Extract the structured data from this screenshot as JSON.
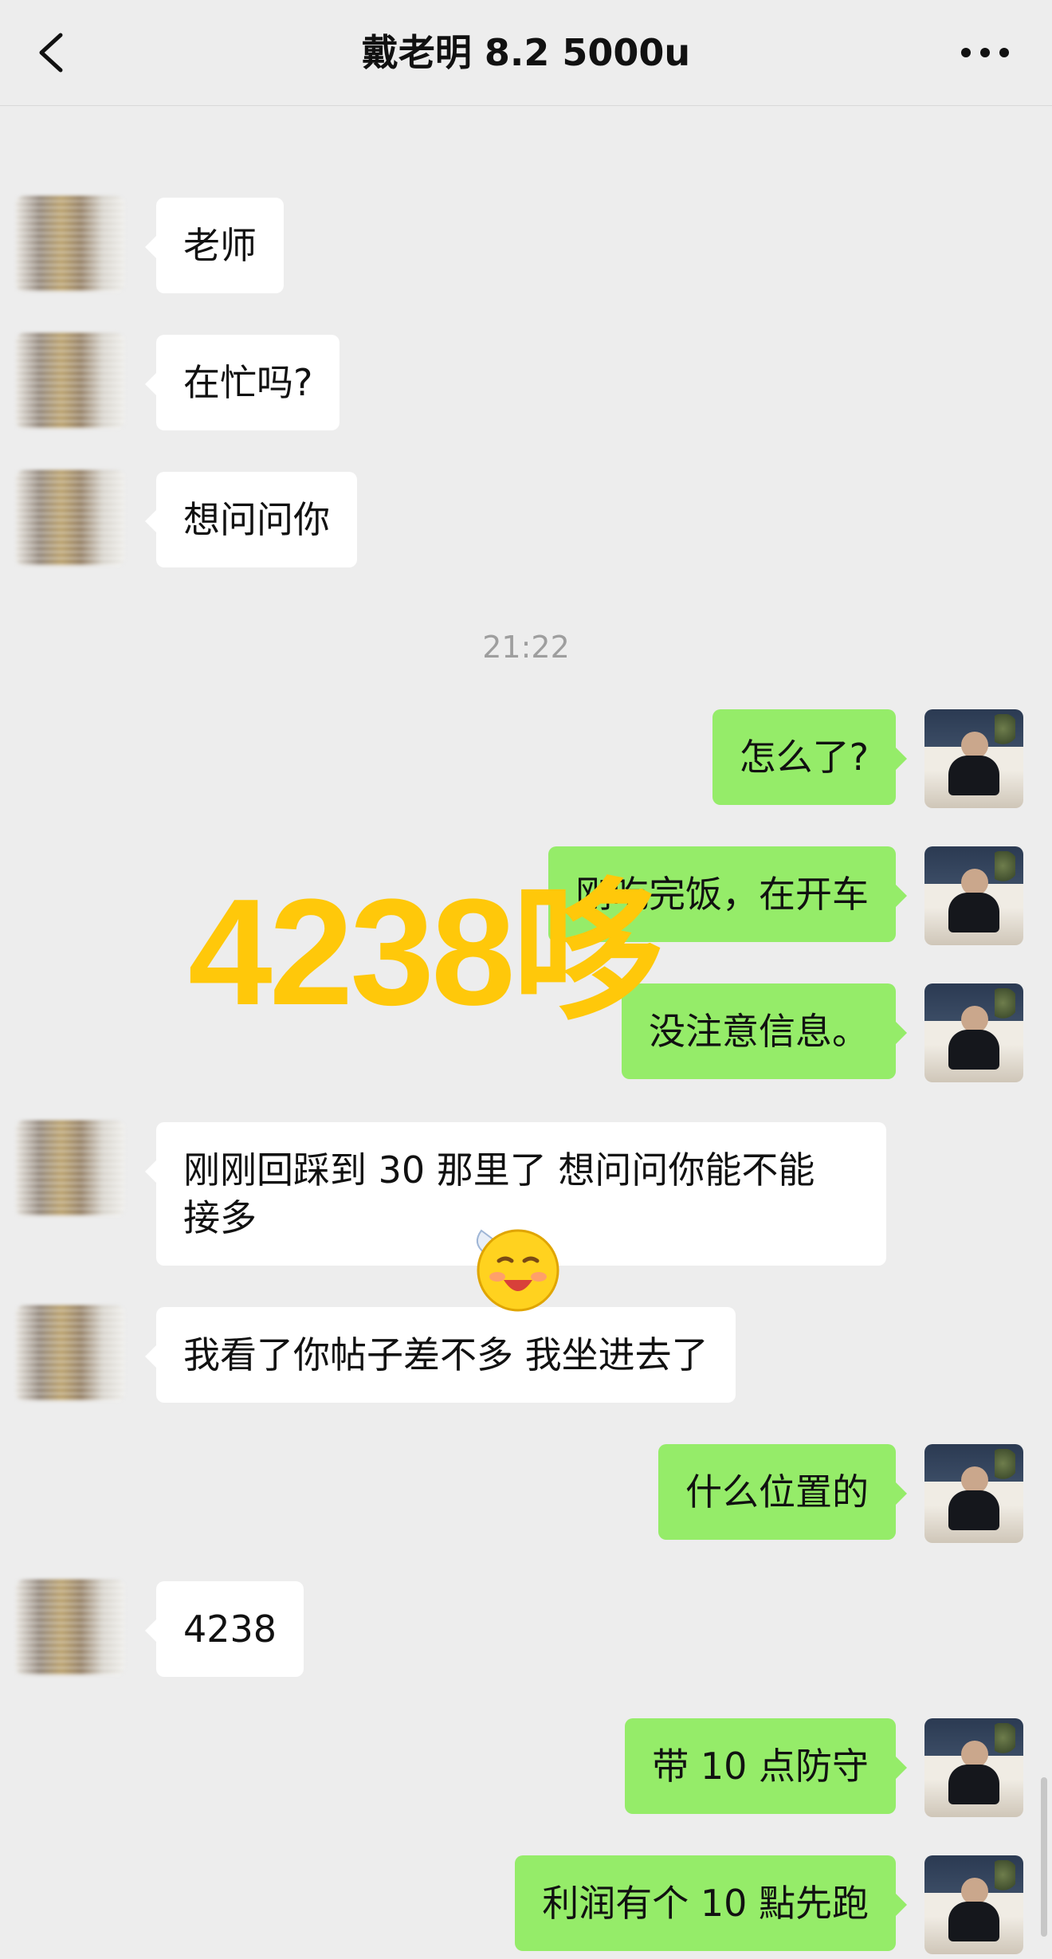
{
  "header": {
    "title": "戴老明 8.2  5000u",
    "back_icon": "chevron-left-icon",
    "more_icon": "more-horizontal-icon"
  },
  "chat": {
    "timestamp": "21:22",
    "watermark": "4238哆",
    "messages": [
      {
        "side": "left",
        "text": "老师"
      },
      {
        "side": "left",
        "text": "在忙吗?"
      },
      {
        "side": "left",
        "text": "想问问你"
      },
      {
        "side": "right",
        "text": "怎么了?"
      },
      {
        "side": "right",
        "text": "刚吃完饭，在开车"
      },
      {
        "side": "right",
        "text": "没注意信息。"
      },
      {
        "side": "left",
        "text": "刚刚回踩到 30 那里了 想问问你能不能\n接多"
      },
      {
        "side": "left",
        "text": "我看了你帖子差不多 我坐进去了"
      },
      {
        "side": "right",
        "text": "什么位置的"
      },
      {
        "side": "left",
        "text": "4238"
      },
      {
        "side": "right",
        "text": "带 10 点防守"
      },
      {
        "side": "right",
        "text": "利润有个 10 點先跑"
      }
    ]
  },
  "colors": {
    "background": "#ededed",
    "bubble_left": "#ffffff",
    "bubble_right": "#95ec69",
    "watermark": "#ffc80a",
    "timestamp": "#9e9e9e"
  }
}
